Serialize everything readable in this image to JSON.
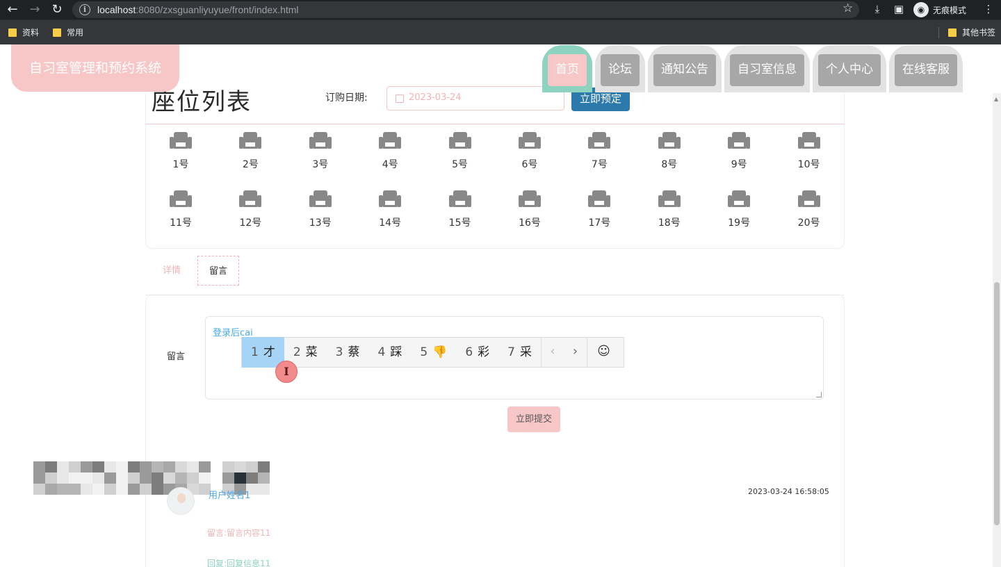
{
  "browser": {
    "url_host": "localhost",
    "url_path": ":8080/zxsguanliyuyue/front/index.html",
    "incognito_label": "无痕模式",
    "bookmarks": [
      "资料",
      "常用"
    ],
    "other_bookmarks": "其他书签"
  },
  "brand": {
    "title": "自习室管理和预约系统"
  },
  "nav": {
    "items": [
      {
        "label": "首页",
        "active": true
      },
      {
        "label": "论坛"
      },
      {
        "label": "通知公告"
      },
      {
        "label": "自习室信息"
      },
      {
        "label": "个人中心"
      },
      {
        "label": "在线客服"
      }
    ]
  },
  "seats": {
    "title": "座位列表",
    "date_label": "订购日期:",
    "date_value": "2023-03-24",
    "reserve_button": "立即预定",
    "items": [
      "1号",
      "2号",
      "3号",
      "4号",
      "5号",
      "6号",
      "7号",
      "8号",
      "9号",
      "10号",
      "11号",
      "12号",
      "13号",
      "14号",
      "15号",
      "16号",
      "17号",
      "18号",
      "19号",
      "20号"
    ]
  },
  "tabs": {
    "detail": "详情",
    "comment": "留言"
  },
  "comment_form": {
    "label": "留言",
    "typed_text": "登录后cai",
    "submit_button": "立即提交"
  },
  "ime": {
    "candidates": [
      {
        "num": "1",
        "text": "才",
        "selected": true
      },
      {
        "num": "2",
        "text": "菜"
      },
      {
        "num": "3",
        "text": "蔡"
      },
      {
        "num": "4",
        "text": "踩"
      },
      {
        "num": "5",
        "text": "👎"
      },
      {
        "num": "6",
        "text": "彩"
      },
      {
        "num": "7",
        "text": "采"
      }
    ],
    "prev": "‹",
    "next": "›",
    "emoji": "☺"
  },
  "comment": {
    "username": "用户姓名1",
    "timestamp": "2023-03-24 16:58:05",
    "message": "留言:留言内容11",
    "reply": "回复:回复信息11"
  },
  "colors": {
    "pink": "#f7c7c8",
    "mint": "#8dd3bf",
    "blue_button": "#2c7aab",
    "nav_gray": "#a7a7a7"
  }
}
